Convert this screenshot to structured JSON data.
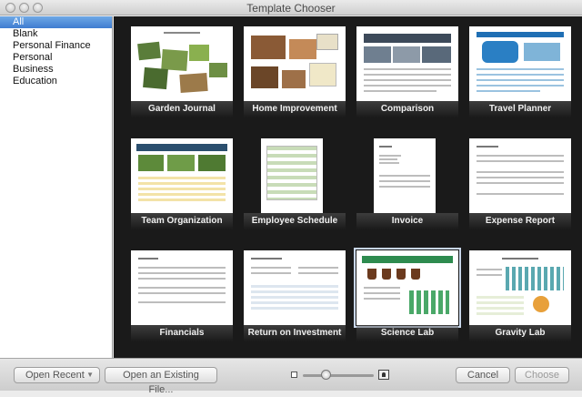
{
  "window": {
    "title": "Template Chooser"
  },
  "sidebar": {
    "categories": [
      {
        "label": "All",
        "selected": true
      },
      {
        "label": "Blank",
        "selected": false
      },
      {
        "label": "Personal Finance",
        "selected": false
      },
      {
        "label": "Personal",
        "selected": false
      },
      {
        "label": "Business",
        "selected": false
      },
      {
        "label": "Education",
        "selected": false
      }
    ]
  },
  "templates": [
    {
      "label": "Garden Journal",
      "selected": false
    },
    {
      "label": "Home Improvement",
      "selected": false
    },
    {
      "label": "Comparison",
      "selected": false
    },
    {
      "label": "Travel Planner",
      "selected": false
    },
    {
      "label": "Team Organization",
      "selected": false
    },
    {
      "label": "Employee Schedule",
      "selected": false
    },
    {
      "label": "Invoice",
      "selected": false
    },
    {
      "label": "Expense Report",
      "selected": false
    },
    {
      "label": "Financials",
      "selected": false
    },
    {
      "label": "Return on Investment",
      "selected": false
    },
    {
      "label": "Science Lab",
      "selected": true
    },
    {
      "label": "Gravity Lab",
      "selected": false
    }
  ],
  "footer": {
    "open_recent": "Open Recent",
    "open_existing": "Open an Existing File...",
    "cancel": "Cancel",
    "choose": "Choose",
    "zoom_level": 0.3
  },
  "colors": {
    "selection": "#3f7cd0",
    "grid_background": "#1a1a1a",
    "science_green": "#2e8b4f",
    "travel_blue": "#1f6fb4"
  }
}
